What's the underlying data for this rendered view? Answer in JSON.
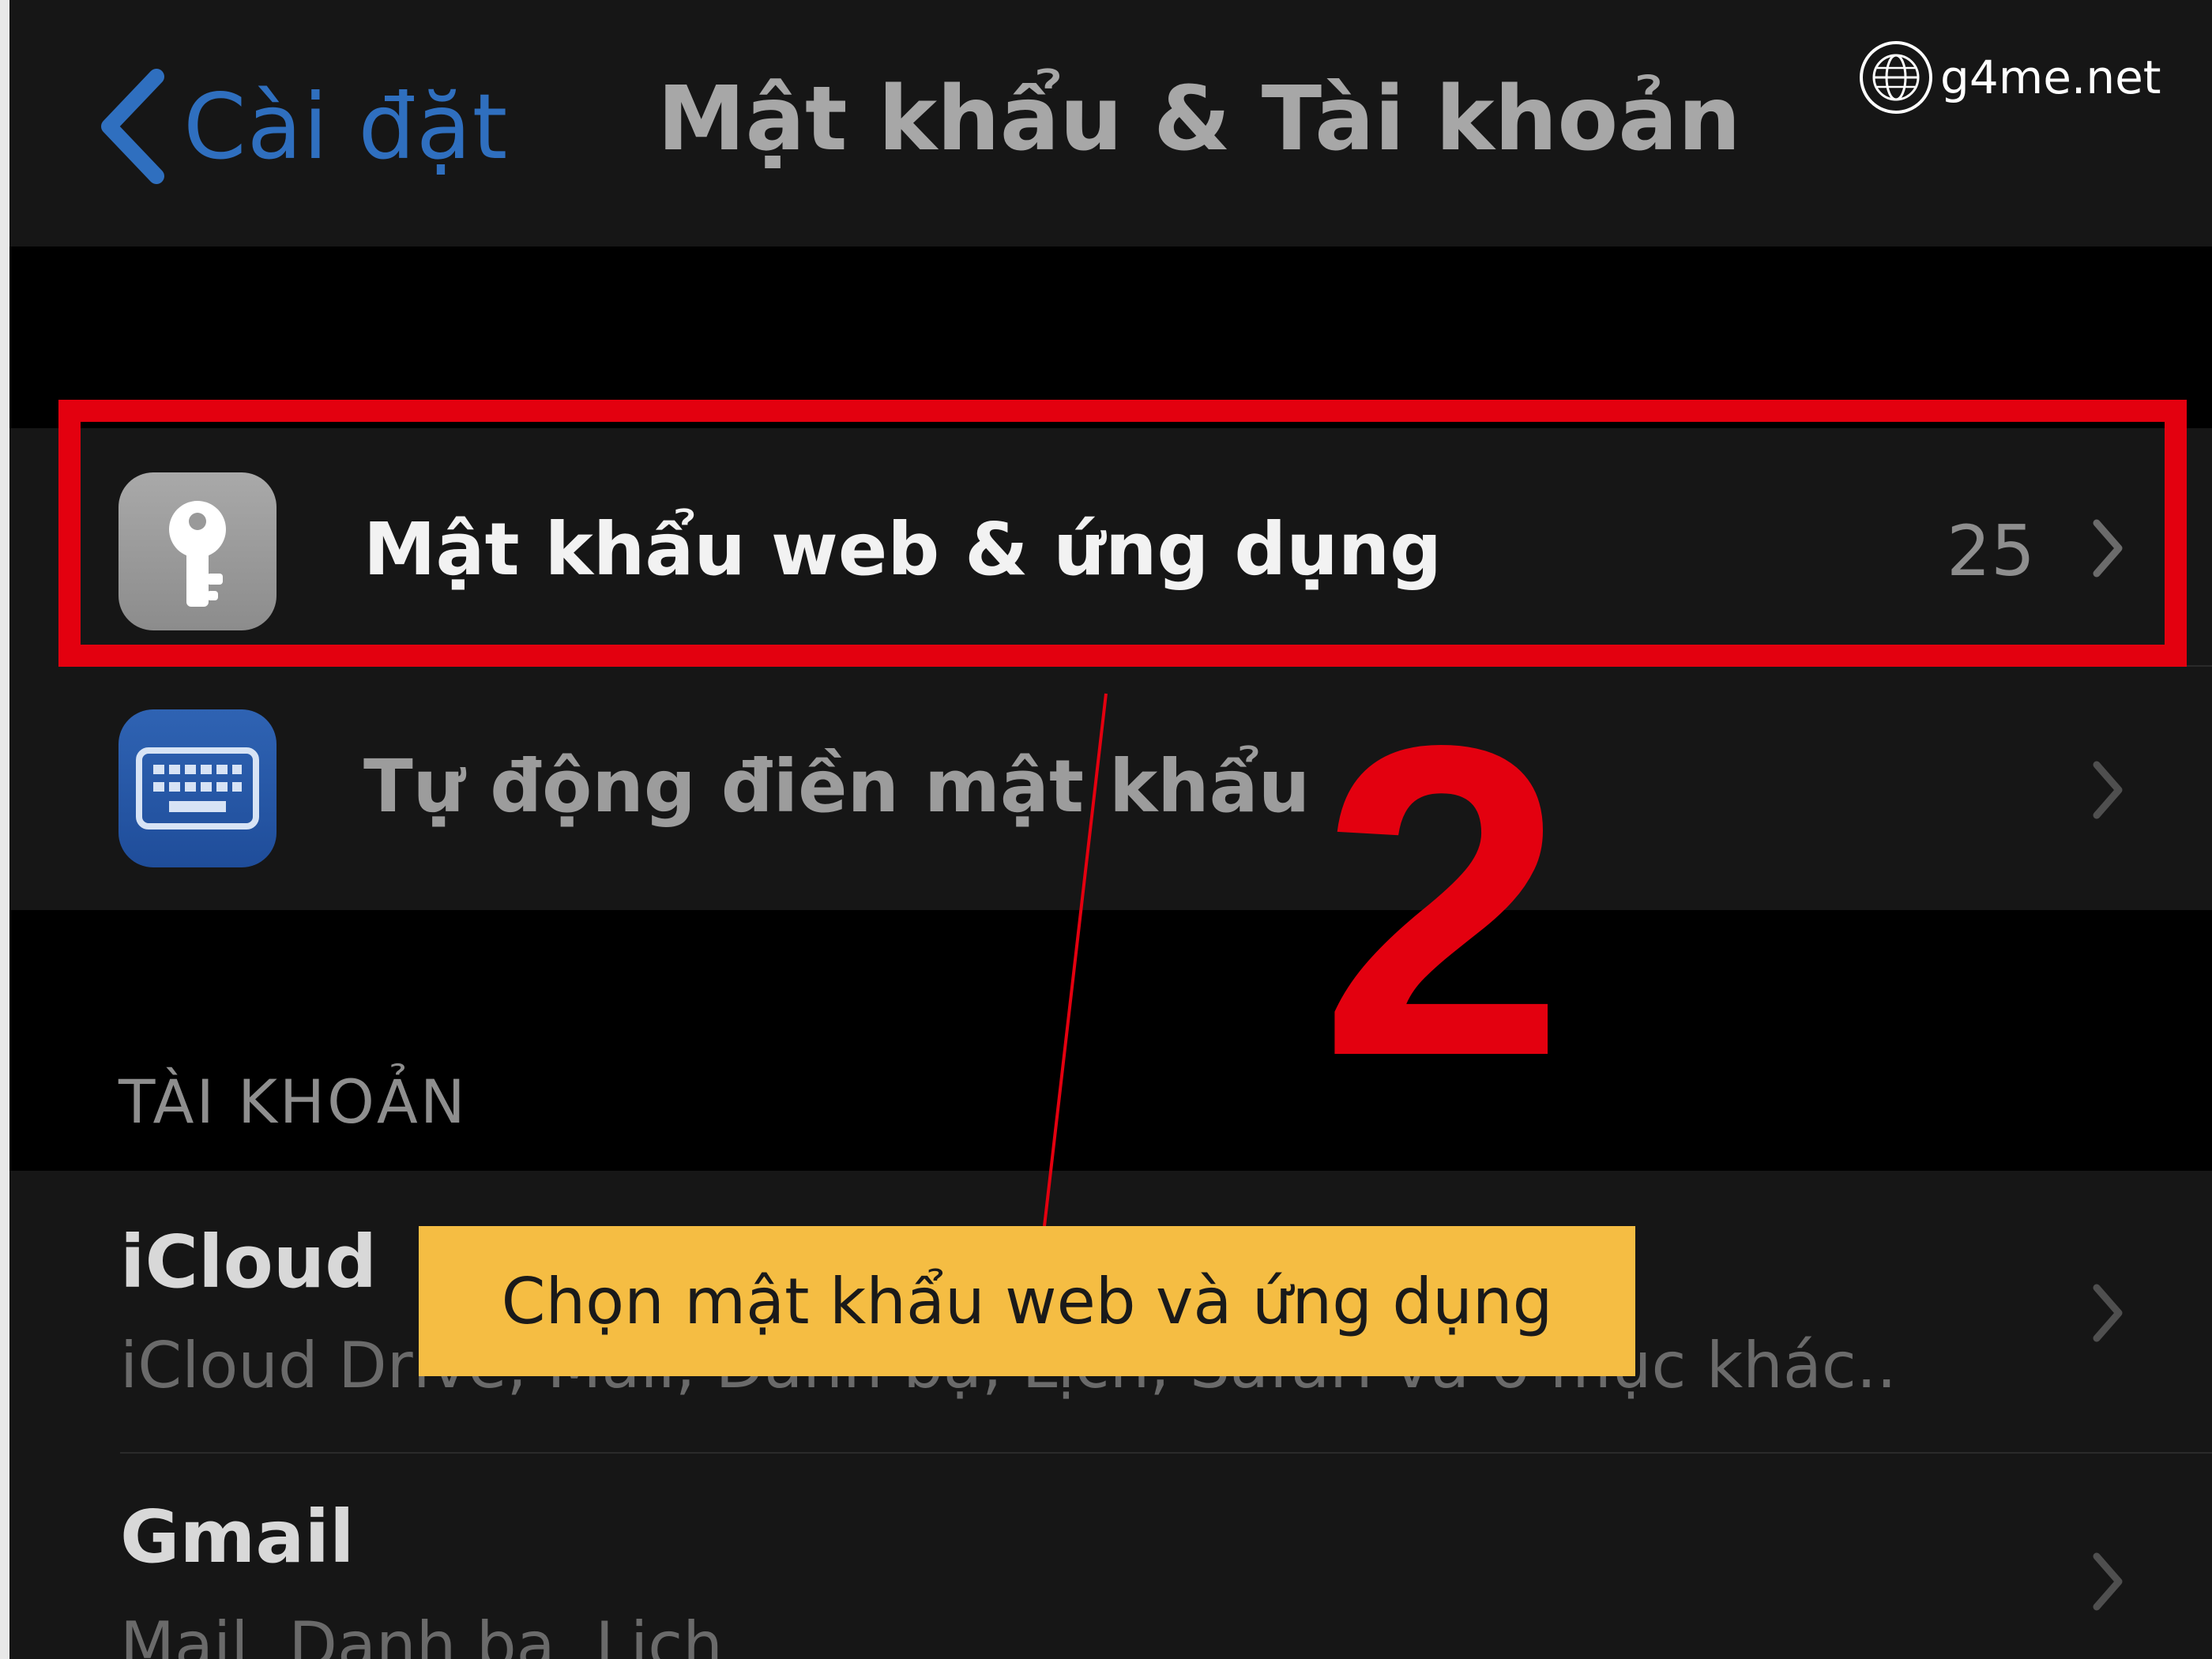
{
  "watermark": {
    "text": "g4me.net",
    "icon": "globe-icon"
  },
  "navbar": {
    "back_label": "Cài đặt",
    "title": "Mật khẩu & Tài khoản"
  },
  "password_group": {
    "items": [
      {
        "label": "Mật khẩu web & ứng dụng",
        "value": "25",
        "icon": "key-icon"
      },
      {
        "label": "Tự động điền mật khẩu",
        "icon": "keyboard-icon"
      }
    ]
  },
  "accounts": {
    "header": "TÀI KHOẢN",
    "items": [
      {
        "title": "iCloud",
        "subtitle": "iCloud Drive, Mail, Danh bạ, Lịch, Safari và 6 mục khác..."
      },
      {
        "title": "Gmail",
        "subtitle": "Mail, Danh bạ, Lịch"
      }
    ]
  },
  "annotation": {
    "step_number": "2",
    "callout": "Chọn mật khẩu web và ứng dụng",
    "highlight_color": "#e3000f",
    "callout_color": "#f5bd43"
  }
}
